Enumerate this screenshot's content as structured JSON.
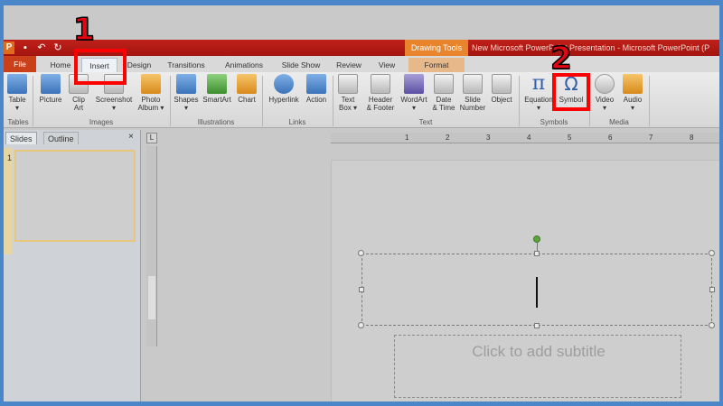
{
  "window": {
    "context_tab_group": "Drawing Tools",
    "title": "New Microsoft PowerPoint Presentation - Microsoft PowerPoint (P"
  },
  "quick_access": {
    "app_icon": "P"
  },
  "tabs": [
    {
      "label": "File"
    },
    {
      "label": "Home"
    },
    {
      "label": "Insert"
    },
    {
      "label": "Design"
    },
    {
      "label": "Transitions"
    },
    {
      "label": "Animations"
    },
    {
      "label": "Slide Show"
    },
    {
      "label": "Review"
    },
    {
      "label": "View"
    },
    {
      "label": "Format"
    }
  ],
  "ribbon": {
    "buttons": [
      {
        "label": "Table\n▾",
        "icon": "table-icon"
      },
      {
        "label": "Picture",
        "icon": "picture-icon"
      },
      {
        "label": "Clip\nArt",
        "icon": "clip-art-icon"
      },
      {
        "label": "Screenshot\n▾",
        "icon": "screenshot-icon"
      },
      {
        "label": "Photo\nAlbum ▾",
        "icon": "photo-album-icon"
      },
      {
        "label": "Shapes\n▾",
        "icon": "shapes-icon"
      },
      {
        "label": "SmartArt",
        "icon": "smartart-icon"
      },
      {
        "label": "Chart",
        "icon": "chart-icon"
      },
      {
        "label": "Hyperlink",
        "icon": "hyperlink-icon"
      },
      {
        "label": "Action",
        "icon": "action-icon"
      },
      {
        "label": "Text\nBox ▾",
        "icon": "text-box-icon"
      },
      {
        "label": "Header\n& Footer",
        "icon": "header-footer-icon"
      },
      {
        "label": "WordArt\n▾",
        "icon": "wordart-icon"
      },
      {
        "label": "Date\n& Time",
        "icon": "date-time-icon"
      },
      {
        "label": "Slide\nNumber",
        "icon": "slide-number-icon"
      },
      {
        "label": "Object",
        "icon": "object-icon"
      },
      {
        "label": "Equation\n▾",
        "icon": "equation-icon",
        "glyph": "π"
      },
      {
        "label": "Symbol",
        "icon": "symbol-icon",
        "glyph": "Ω"
      },
      {
        "label": "Video\n▾",
        "icon": "video-icon"
      },
      {
        "label": "Audio\n▾",
        "icon": "audio-icon"
      }
    ],
    "groups": [
      {
        "label": "Tables"
      },
      {
        "label": "Images"
      },
      {
        "label": "Illustrations"
      },
      {
        "label": "Links"
      },
      {
        "label": "Text"
      },
      {
        "label": "Symbols"
      },
      {
        "label": "Media"
      }
    ]
  },
  "slides_panel": {
    "tabs": [
      "Slides",
      "Outline"
    ],
    "close_glyph": "×",
    "slide_number": "1"
  },
  "rulers": {
    "corner_glyph": "L",
    "horizontal_numbers": [
      "1",
      "2",
      "3",
      "4",
      "5",
      "6",
      "7",
      "8"
    ]
  },
  "slide": {
    "subtitle_placeholder": "Click to add subtitle"
  },
  "annotations": [
    {
      "number": "1",
      "target": "Insert tab"
    },
    {
      "number": "2",
      "target": "Symbol button"
    }
  ],
  "colors": {
    "title_bar": "#b0160f",
    "file_tab": "#c9401b",
    "format_tab": "#e7b98a",
    "callout": "#ff0000",
    "outer_border": "#4b86c8"
  }
}
